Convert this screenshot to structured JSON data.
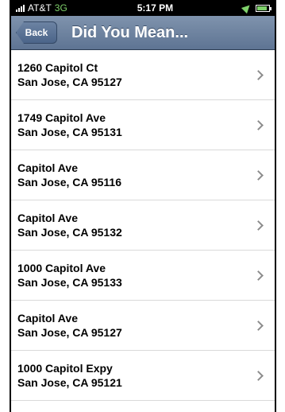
{
  "status_bar": {
    "carrier": "AT&T",
    "network": "3G",
    "time": "5:17 PM",
    "signal_icon": "signal-bars-icon",
    "location_icon": "location-arrow-icon",
    "battery_icon": "battery-icon"
  },
  "nav": {
    "back_label": "Back",
    "title": "Did You Mean..."
  },
  "results": [
    {
      "line1": "1260 Capitol Ct",
      "line2": "San Jose, CA 95127"
    },
    {
      "line1": "1749 Capitol Ave",
      "line2": "San Jose, CA 95131"
    },
    {
      "line1": "Capitol Ave",
      "line2": "San Jose, CA 95116"
    },
    {
      "line1": "Capitol Ave",
      "line2": "San Jose, CA 95132"
    },
    {
      "line1": "1000 Capitol Ave",
      "line2": "San Jose, CA 95133"
    },
    {
      "line1": "Capitol Ave",
      "line2": "San Jose, CA 95127"
    },
    {
      "line1": "1000 Capitol Expy",
      "line2": "San Jose, CA 95121"
    }
  ],
  "colors": {
    "navbar": "#6e84a2",
    "network_text": "#7fd16b",
    "chevron": "#8c8c8c"
  }
}
